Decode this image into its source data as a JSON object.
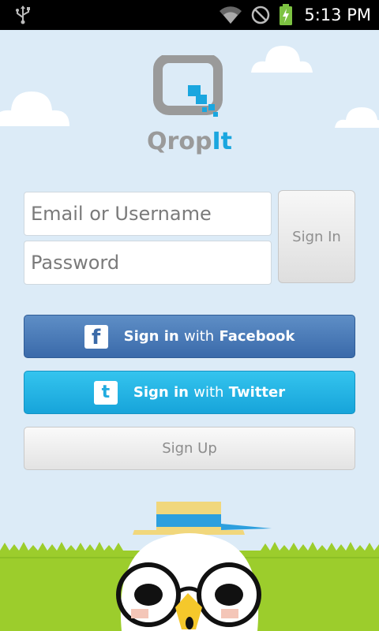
{
  "status_bar": {
    "time": "5:13 PM",
    "icons": [
      "usb-icon",
      "wifi-icon",
      "do-not-disturb-icon",
      "battery-charging-icon"
    ]
  },
  "logo": {
    "text_part1": "Qrop",
    "text_part2": "It",
    "colors": {
      "gray": "#9a9a9a",
      "blue": "#1aa6df"
    }
  },
  "form": {
    "email_placeholder": "Email or Username",
    "password_placeholder": "Password",
    "signin_label": "Sign In"
  },
  "social": {
    "facebook": {
      "bold": "Sign in",
      "with": "with",
      "brand": "Facebook",
      "icon": "facebook-icon",
      "color": "#4a7ab8"
    },
    "twitter": {
      "bold": "Sign in",
      "with": "with",
      "brand": "Twitter",
      "icon": "twitter-icon",
      "color": "#22b0e3"
    }
  },
  "signup": {
    "label": "Sign Up"
  },
  "colors": {
    "sky": "#dcebf7",
    "grass": "#9ccd2c"
  }
}
